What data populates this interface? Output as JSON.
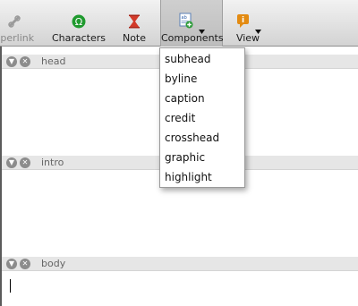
{
  "toolbar": {
    "items": [
      {
        "label": "yperlink",
        "icon": "hyperlink-icon"
      },
      {
        "label": "Characters",
        "icon": "omega-icon"
      },
      {
        "label": "Note",
        "icon": "hourglass-icon"
      },
      {
        "label": "Components",
        "icon": "components-icon"
      },
      {
        "label": "View",
        "icon": "view-icon"
      }
    ]
  },
  "sections": [
    {
      "label": "head"
    },
    {
      "label": "intro"
    },
    {
      "label": "body"
    }
  ],
  "components_menu": {
    "items": [
      "subhead",
      "byline",
      "caption",
      "credit",
      "crosshead",
      "graphic",
      "highlight"
    ]
  },
  "colors": {
    "omega_icon": "#1f9a2e",
    "note_icon": "#d23a2a",
    "view_icon": "#e38b12",
    "section_bar": "#e6e6e6"
  }
}
